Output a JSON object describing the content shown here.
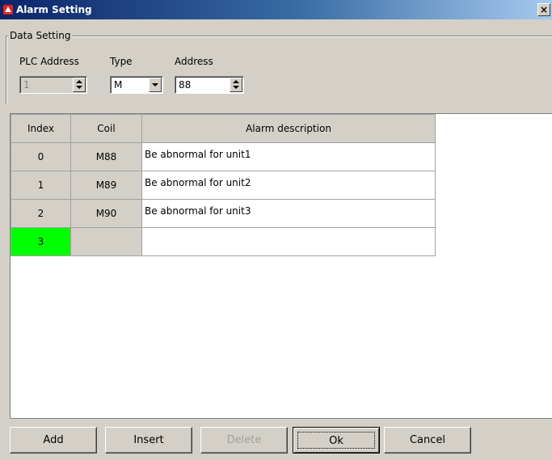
{
  "window": {
    "title": "Alarm Setting",
    "close_glyph": "×",
    "icon": "warning-triangle-icon"
  },
  "data_setting": {
    "legend": "Data Setting",
    "plc_address_label": "PLC Address",
    "type_label": "Type",
    "address_label": "Address",
    "plc_address_value": "1",
    "type_value": "M",
    "address_value": "88"
  },
  "grid": {
    "headers": [
      "Index",
      "Coil",
      "Alarm description"
    ],
    "rows": [
      {
        "index": "0",
        "coil": "M88",
        "desc": "Be abnormal for unit1"
      },
      {
        "index": "1",
        "coil": "M89",
        "desc": "Be abnormal for unit2"
      },
      {
        "index": "2",
        "coil": "M90",
        "desc": "Be abnormal for unit3"
      },
      {
        "index": "3",
        "coil": "",
        "desc": ""
      }
    ],
    "current_row_color": "#00ff00"
  },
  "buttons": {
    "add": "Add",
    "insert": "Insert",
    "delete": "Delete",
    "ok": "Ok",
    "cancel": "Cancel"
  }
}
